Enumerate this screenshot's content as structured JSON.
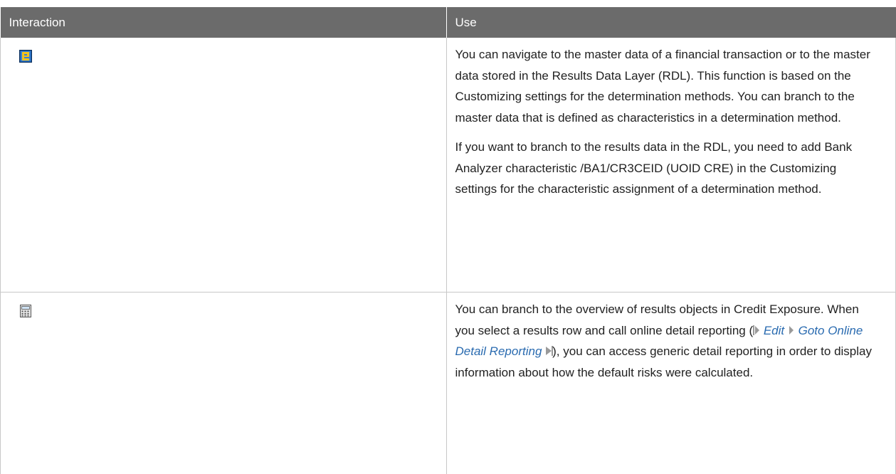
{
  "table": {
    "headers": [
      "Interaction",
      "Use"
    ],
    "rows": [
      {
        "icon": "navigate-master-data-icon",
        "paragraphs": [
          "You can navigate to the master data of a financial transaction or to the master data stored in the Results Data Layer (RDL). This function is based on the Customizing settings for the determination methods. You can branch to the master data that is defined as characteristics in a determination method.",
          "If you want to branch to the results data in the RDL, you need to add Bank Analyzer characteristic /BA1/CR3CEID (UOID CRE) in the Customizing settings for the characteristic assignment of a determination method."
        ]
      },
      {
        "icon": "calculator-icon",
        "text_before": "You can branch to the overview of results objects in Credit Exposure. When you select a results row and call online detail reporting (",
        "menu_path": [
          "Edit",
          "Goto Online Detail Reporting"
        ],
        "text_after": "), you can access generic detail reporting in order to display information about how the default risks were calculated."
      }
    ]
  }
}
